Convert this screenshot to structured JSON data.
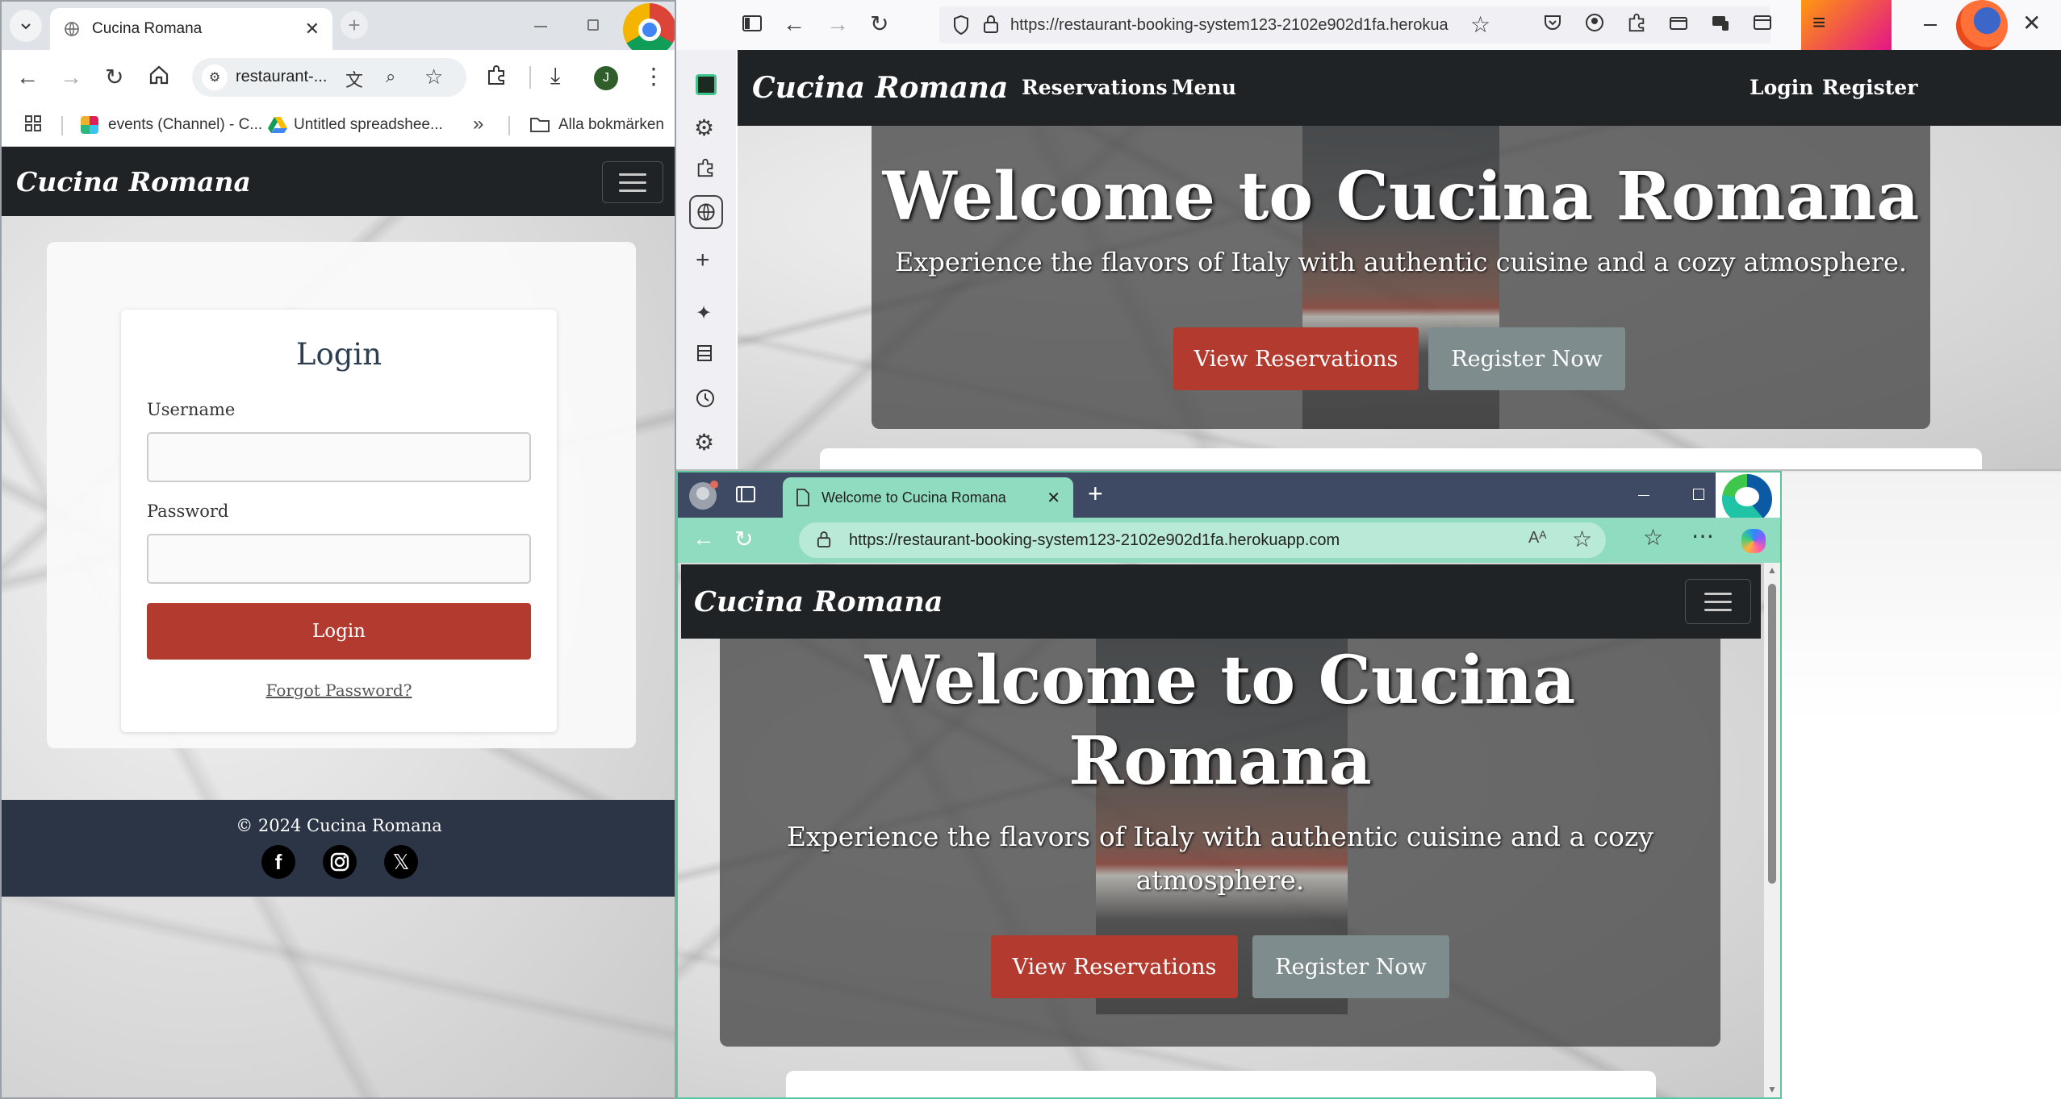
{
  "chrome": {
    "tab_title": "Cucina Romana",
    "address": "restaurant-...",
    "bookmarks": [
      "events (Channel) - C...",
      "Untitled spreadshee..."
    ],
    "bookmarks_more": "»",
    "all_bookmarks": "Alla bokmärken",
    "profile_initial": "J",
    "site": {
      "brand": "Cucina Romana",
      "login_title": "Login",
      "username_label": "Username",
      "password_label": "Password",
      "login_button": "Login",
      "forgot": "Forgot Password?",
      "footer": "© 2024 Cucina Romana"
    }
  },
  "firefox": {
    "url": "https://restaurant-booking-system123-2102e902d1fa.herokua",
    "site": {
      "brand": "Cucina Romana",
      "nav": [
        "Reservations",
        "Menu"
      ],
      "nav_right": [
        "Login",
        "Register"
      ],
      "hero_title": "Welcome to Cucina Romana",
      "hero_sub": "Experience the flavors of Italy with authentic cuisine and a cozy atmosphere.",
      "btn_reservations": "View Reservations",
      "btn_register": "Register Now"
    }
  },
  "edge": {
    "tab_title": "Welcome to Cucina Romana",
    "url": "https://restaurant-booking-system123-2102e902d1fa.herokuapp.com",
    "site": {
      "brand": "Cucina Romana",
      "hero_title_1": "Welcome to Cucina",
      "hero_title_2": "Romana",
      "hero_sub_1": "Experience the flavors of Italy with authentic cuisine and a cozy",
      "hero_sub_2": "atmosphere.",
      "btn_reservations": "View Reservations",
      "btn_register": "Register Now"
    }
  },
  "colors": {
    "accent_red": "#b33a2e",
    "navbar": "#1f2326",
    "footer": "#2c3545",
    "edge_green": "#8fdcc0"
  }
}
